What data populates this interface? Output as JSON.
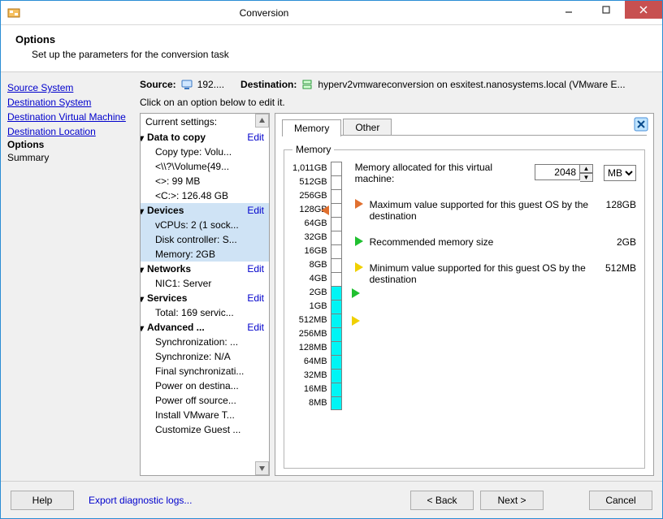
{
  "window": {
    "title": "Conversion"
  },
  "header": {
    "title": "Options",
    "subtitle": "Set up the parameters for the conversion task"
  },
  "nav": {
    "items": [
      "Source System",
      "Destination System",
      "Destination Virtual Machine",
      "Destination Location",
      "Options",
      "Summary"
    ],
    "current_index": 4
  },
  "srcdest": {
    "source_label": "Source:",
    "source_value": "192....",
    "dest_label": "Destination:",
    "dest_value": "hyperv2vmwareconversion on esxitest.nanosystems.local (VMware E..."
  },
  "hint": "Click on an option below to edit it.",
  "tree": {
    "heading": "Current settings:",
    "groups": [
      {
        "label": "Data to copy",
        "edit": "Edit",
        "selected": false,
        "items": [
          "Copy type: Volu...",
          "<\\\\?\\Volume{49...",
          "<>: 99 MB",
          "<C:>: 126.48 GB"
        ]
      },
      {
        "label": "Devices",
        "edit": "Edit",
        "selected": true,
        "items": [
          "vCPUs: 2 (1 sock...",
          "Disk controller: S...",
          "Memory: 2GB"
        ]
      },
      {
        "label": "Networks",
        "edit": "Edit",
        "selected": false,
        "items": [
          "NIC1: Server"
        ]
      },
      {
        "label": "Services",
        "edit": "Edit",
        "selected": false,
        "items": [
          "Total: 169 servic..."
        ]
      },
      {
        "label": "Advanced ...",
        "edit": "Edit",
        "selected": false,
        "items": [
          "Synchronization: ...",
          "Synchronize: N/A",
          "Final synchronizati...",
          "Power on destina...",
          "Power off source...",
          "Install VMware T...",
          "Customize Guest ..."
        ]
      }
    ]
  },
  "tabs": {
    "items": [
      "Memory",
      "Other"
    ],
    "active": 0
  },
  "memory": {
    "legend": "Memory",
    "gauge_labels": [
      "1,011GB",
      "512GB",
      "256GB",
      "128GB",
      "64GB",
      "32GB",
      "16GB",
      "8GB",
      "4GB",
      "2GB",
      "1GB",
      "512MB",
      "256MB",
      "128MB",
      "64MB",
      "32MB",
      "16MB",
      "8MB"
    ],
    "fill_from_index": 9,
    "markers": {
      "max_index": 3,
      "rec_index": 9,
      "min_index": 11
    },
    "alloc_label": "Memory allocated for this virtual machine:",
    "alloc_value": "2048",
    "alloc_unit": "MB",
    "rows": [
      {
        "text": "Maximum value supported for this guest OS by the destination",
        "value": "128GB",
        "color": "orange"
      },
      {
        "text": "Recommended memory size",
        "value": "2GB",
        "color": "green"
      },
      {
        "text": "Minimum value supported for this guest OS by the destination",
        "value": "512MB",
        "color": "yellow"
      }
    ]
  },
  "footer": {
    "help": "Help",
    "export": "Export diagnostic logs...",
    "back": "< Back",
    "next": "Next >",
    "cancel": "Cancel"
  }
}
